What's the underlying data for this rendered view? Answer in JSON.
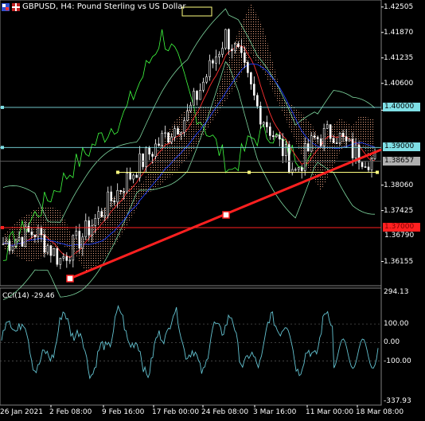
{
  "header": {
    "symbol": "GBPUSD",
    "timeframe": "H4",
    "description": "Pound Sterling vs US Dollar",
    "title_text": "GBPUSD, H4:  Pound Sterling vs US Dollar"
  },
  "price_axis": {
    "labels": [
      "1.42505",
      "1.41870",
      "1.41235",
      "1.40600",
      "1.39930",
      "1.38060",
      "1.37425",
      "1.36155"
    ]
  },
  "price_tags": [
    {
      "label": "1.40000",
      "kind": "hline",
      "color": "#7fdfe6"
    },
    {
      "label": "1.39000",
      "kind": "hline",
      "color": "#7fdfe6"
    },
    {
      "label": "1.38657",
      "kind": "bid",
      "color": "#b0b0b0"
    },
    {
      "label": "1.37000",
      "kind": "hline",
      "color": "#ff2020"
    },
    {
      "label": "1.36790",
      "kind": "axis",
      "color": "#ffffff"
    }
  ],
  "indicator": {
    "title": "CCI(14) -29.46",
    "name": "CCI(14)",
    "value": "-29.46",
    "scale_labels": [
      "294.13",
      "100.00",
      "0.00",
      "-100.00",
      "-337.93"
    ]
  },
  "time_axis": {
    "labels": [
      "26 Jan 2021",
      "2 Feb 08:00",
      "9 Feb 16:00",
      "17 Feb 00:00",
      "24 Feb 08:00",
      "3 Mar 16:00",
      "11 Mar 00:00",
      "18 Mar 08:00"
    ]
  },
  "colors": {
    "background": "#000000",
    "bull_candle": "#ffffff",
    "bear_candle": "#ffffff",
    "trendline": "#ff2020",
    "hline_cyan": "#7fdfe6",
    "hline_red": "#ff2020",
    "cci_line": "#63c2d0",
    "kumo": "#e8a080",
    "bollinger": "#7fd8a0",
    "tenkan": "#ff3030",
    "kijun": "#2040ff",
    "chikou": "#40ff40"
  }
}
